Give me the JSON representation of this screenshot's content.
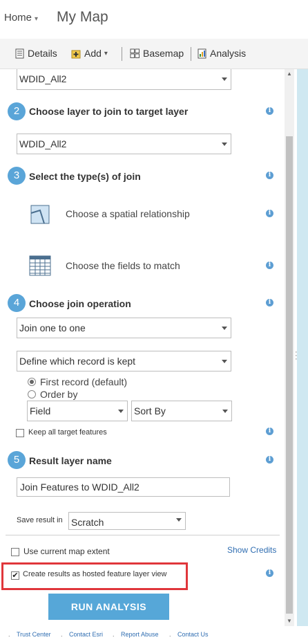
{
  "header": {
    "home_label": "Home",
    "home_caret": "▾",
    "map_title": "My Map"
  },
  "toolbar": {
    "details": "Details",
    "add": "Add",
    "add_caret": "▾",
    "basemap": "Basemap",
    "analysis": "Analysis"
  },
  "panel": {
    "top_select_value": "WDID_All2",
    "step2": {
      "number": "2",
      "title": "Choose layer to join to target layer",
      "select_value": "WDID_All2"
    },
    "step3": {
      "number": "3",
      "title": "Select the type(s) of join",
      "options": [
        "Choose a spatial relationship",
        "Choose the fields to match"
      ]
    },
    "step4": {
      "number": "4",
      "title": "Choose join operation",
      "operation_value": "Join one to one",
      "record_value": "Define which record is kept",
      "radio_first": "First record (default)",
      "radio_order": "Order by",
      "field_value": "Field",
      "sortby_value": "Sort By",
      "keep_all_label": "Keep all target features"
    },
    "step5": {
      "number": "5",
      "title": "Result layer name",
      "name_value": "Join Features to WDID_All2",
      "save_label": "Save result in",
      "save_value": "Scratch"
    },
    "use_extent_label": "Use current map extent",
    "show_credits": "Show Credits",
    "hosted_view_label": "Create results as hosted feature layer view",
    "run_button": "RUN ANALYSIS",
    "info_glyph": "i"
  },
  "footer": {
    "links": [
      "Trust Center",
      "Contact Esri",
      "Report Abuse",
      "Contact Us"
    ]
  },
  "colors": {
    "accent": "#56a7d8",
    "step_circle": "#5aa5d8",
    "highlight": "#e0363b",
    "link": "#2f6db1"
  }
}
